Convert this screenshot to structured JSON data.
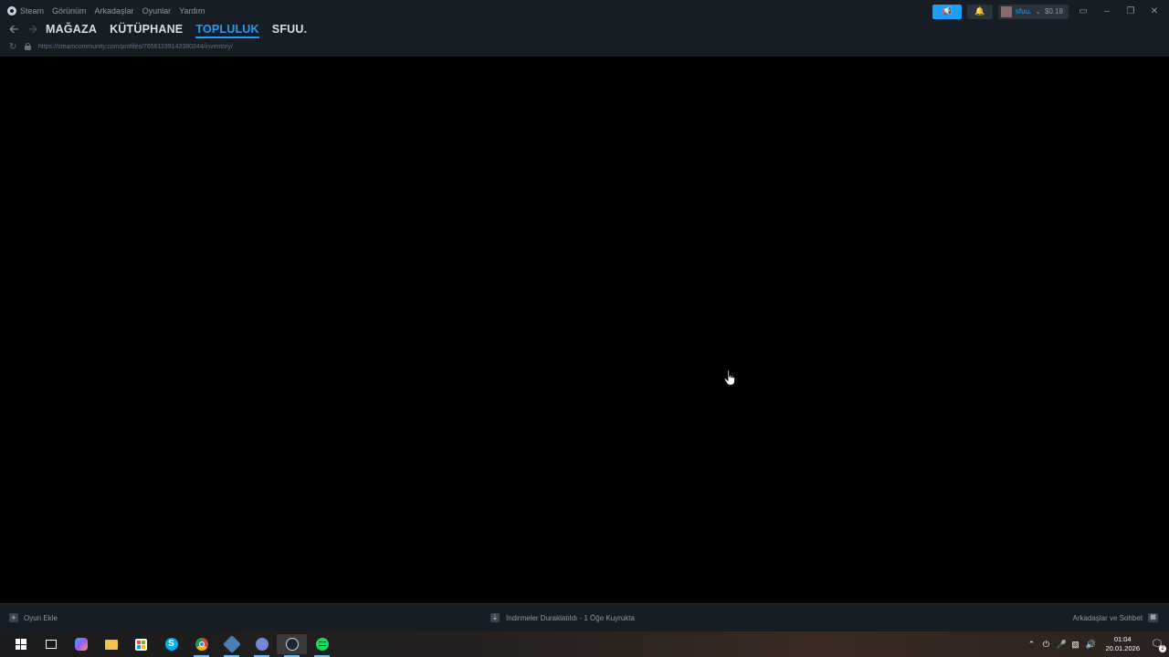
{
  "menu": {
    "steam": "Steam",
    "view": "Görünüm",
    "friends": "Arkadaşlar",
    "games": "Oyunlar",
    "help": "Yardım"
  },
  "nav": {
    "tabs": [
      {
        "label": "MAĞAZA",
        "active": false
      },
      {
        "label": "KÜTÜPHANE",
        "active": false
      },
      {
        "label": "TOPLULUK",
        "active": true
      },
      {
        "label": "SFUU.",
        "active": false
      }
    ]
  },
  "url": "https://steamcommunity.com/profiles/76561199143380244/inventory/",
  "account": {
    "name": "sfuu.",
    "balance": "$0.18"
  },
  "bottombar": {
    "add_game": "Oyun Ekle",
    "downloads": "İndirmeler Duraklatıldı - 1 Öğe Kuyrukta",
    "friends_chat": "Arkadaşlar ve Sohbet"
  },
  "taskbar": {
    "time": "01:04",
    "date": "20.01.2026",
    "notification_count": "2",
    "apps": [
      "windows-start",
      "task-view",
      "copilot",
      "file-explorer",
      "microsoft-store",
      "skype",
      "chrome",
      "app",
      "discord",
      "steam",
      "spotify"
    ]
  },
  "colors": {
    "accent": "#1a9fff",
    "titlebar": "#171d25",
    "content_bg": "#000000"
  }
}
